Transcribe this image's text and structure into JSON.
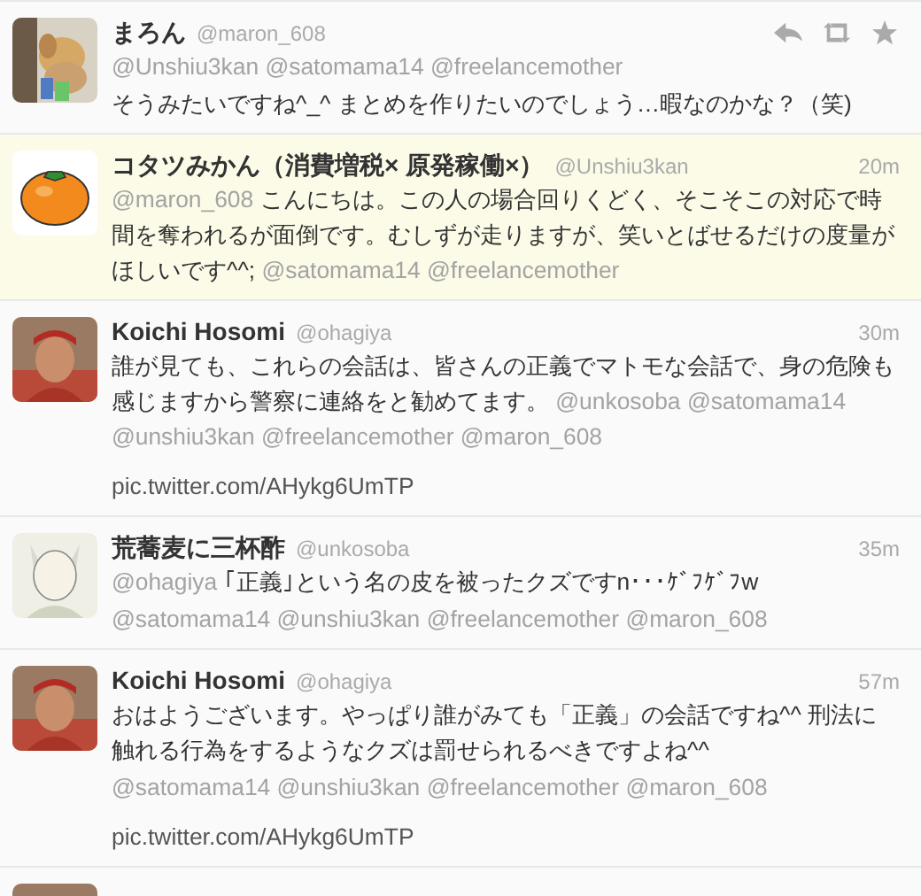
{
  "tweets": [
    {
      "name": "まろん",
      "handle": "@maron_608",
      "highlighted": false,
      "actions": true,
      "avatar": {
        "kind": "picture"
      },
      "paragraphs": [
        [
          {
            "kind": "mention",
            "text": "@Unshiu3kan"
          },
          {
            "kind": "mention",
            "text": "@satomama14"
          },
          {
            "kind": "mention",
            "text": "@freelancemother"
          }
        ],
        [
          {
            "kind": "text",
            "text": "そうみたいですね^_^ まとめを作りたいのでしょう…暇なのかな？（笑)"
          }
        ]
      ]
    },
    {
      "name": "コタツみかん（消費増税× 原発稼働×）",
      "handle": "@Unshiu3kan",
      "time": "20m",
      "highlighted": true,
      "actions": false,
      "avatar": {
        "kind": "picture"
      },
      "paragraphs": [
        [
          {
            "kind": "mention",
            "text": "@maron_608"
          },
          {
            "kind": "text",
            "text": "こんにちは。この人の場合回りくどく、そこそこの対応で時間を奪われるが面倒です。むしずが走りますが、笑いとばせるだけの度量がほしいです^^;"
          },
          {
            "kind": "mention",
            "text": "@satomama14"
          },
          {
            "kind": "mention",
            "text": "@freelancemother"
          }
        ]
      ]
    },
    {
      "name": "Koichi Hosomi",
      "handle": "@ohagiya",
      "time": "30m",
      "highlighted": false,
      "actions": false,
      "avatar": {
        "kind": "picture"
      },
      "paragraphs": [
        [
          {
            "kind": "text",
            "text": "誰が見ても、これらの会話は、皆さんの正義でマトモな会話で、身の危険も感じますから警察に連絡をと勧めてます。"
          },
          {
            "kind": "mention",
            "text": "@unkosoba"
          },
          {
            "kind": "mention",
            "text": "@satomama14"
          },
          {
            "kind": "mention",
            "text": "@unshiu3kan"
          },
          {
            "kind": "mention",
            "text": "@freelancemother"
          },
          {
            "kind": "mention",
            "text": "@maron_608"
          }
        ],
        [
          {
            "kind": "link",
            "text": "pic.twitter.com/AHykg6UmTP"
          }
        ]
      ]
    },
    {
      "name": "荒蕎麦に三杯酢",
      "handle": "@unkosoba",
      "time": "35m",
      "highlighted": false,
      "actions": false,
      "avatar": {
        "kind": "picture"
      },
      "paragraphs": [
        [
          {
            "kind": "mention",
            "text": "@ohagiya"
          },
          {
            "kind": "text",
            "text": "｢正義｣という名の皮を被ったクズですn･･･ｹﾞﾌｹﾞﾌw"
          }
        ],
        [
          {
            "kind": "mention",
            "text": "@satomama14"
          },
          {
            "kind": "mention",
            "text": "@unshiu3kan"
          },
          {
            "kind": "mention",
            "text": "@freelancemother"
          },
          {
            "kind": "mention",
            "text": "@maron_608"
          }
        ]
      ]
    },
    {
      "name": "Koichi Hosomi",
      "handle": "@ohagiya",
      "time": "57m",
      "highlighted": false,
      "actions": false,
      "avatar": {
        "kind": "picture"
      },
      "paragraphs": [
        [
          {
            "kind": "text",
            "text": "おはようございます。やっぱり誰がみても「正義」の会話ですね^^ 刑法に触れる行為をするようなクズは罰せられるべきですよね^^"
          }
        ],
        [
          {
            "kind": "mention",
            "text": "@satomama14"
          },
          {
            "kind": "mention",
            "text": "@unshiu3kan"
          },
          {
            "kind": "mention",
            "text": "@freelancemother"
          },
          {
            "kind": "mention",
            "text": "@maron_608"
          }
        ],
        [
          {
            "kind": "link",
            "text": "pic.twitter.com/AHykg6UmTP"
          }
        ]
      ]
    },
    {
      "avatar": {
        "kind": "picture"
      }
    }
  ]
}
